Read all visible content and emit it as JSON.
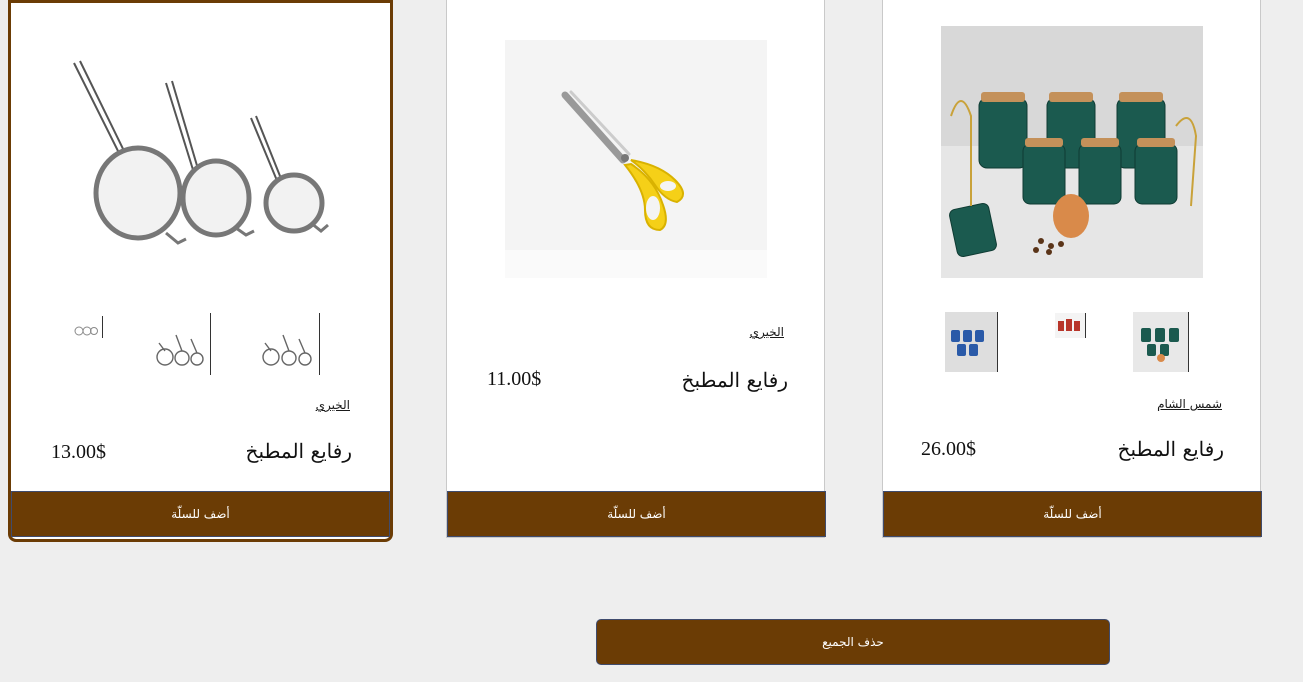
{
  "products": [
    {
      "name": "رفايع المطبخ",
      "price": "13.00$",
      "seller": "الخيري",
      "add_label": "أضف للسلّة",
      "image_icon": "strainer-set-image",
      "thumbnail_icons": [
        "strainer-thumb-icon",
        "strainer-thumb-icon",
        "strainer-thumb-icon"
      ]
    },
    {
      "name": "رفايع المطبخ",
      "price": "11.00$",
      "seller": "الخيري",
      "add_label": "أضف للسلّة",
      "image_icon": "scissors-image"
    },
    {
      "name": "رفايع المطبخ",
      "price": "26.00$",
      "seller": "شمس الشام",
      "add_label": "أضف للسلّة",
      "image_icon": "spice-jars-image",
      "thumbnail_icons": [
        "jar-thumb-icon",
        "jar-thumb-icon",
        "jar-thumb-icon"
      ]
    }
  ],
  "clear_all_label": "حذف الجميع",
  "colors": {
    "button_brown": "#6b3c05",
    "background": "#eeeeee"
  }
}
